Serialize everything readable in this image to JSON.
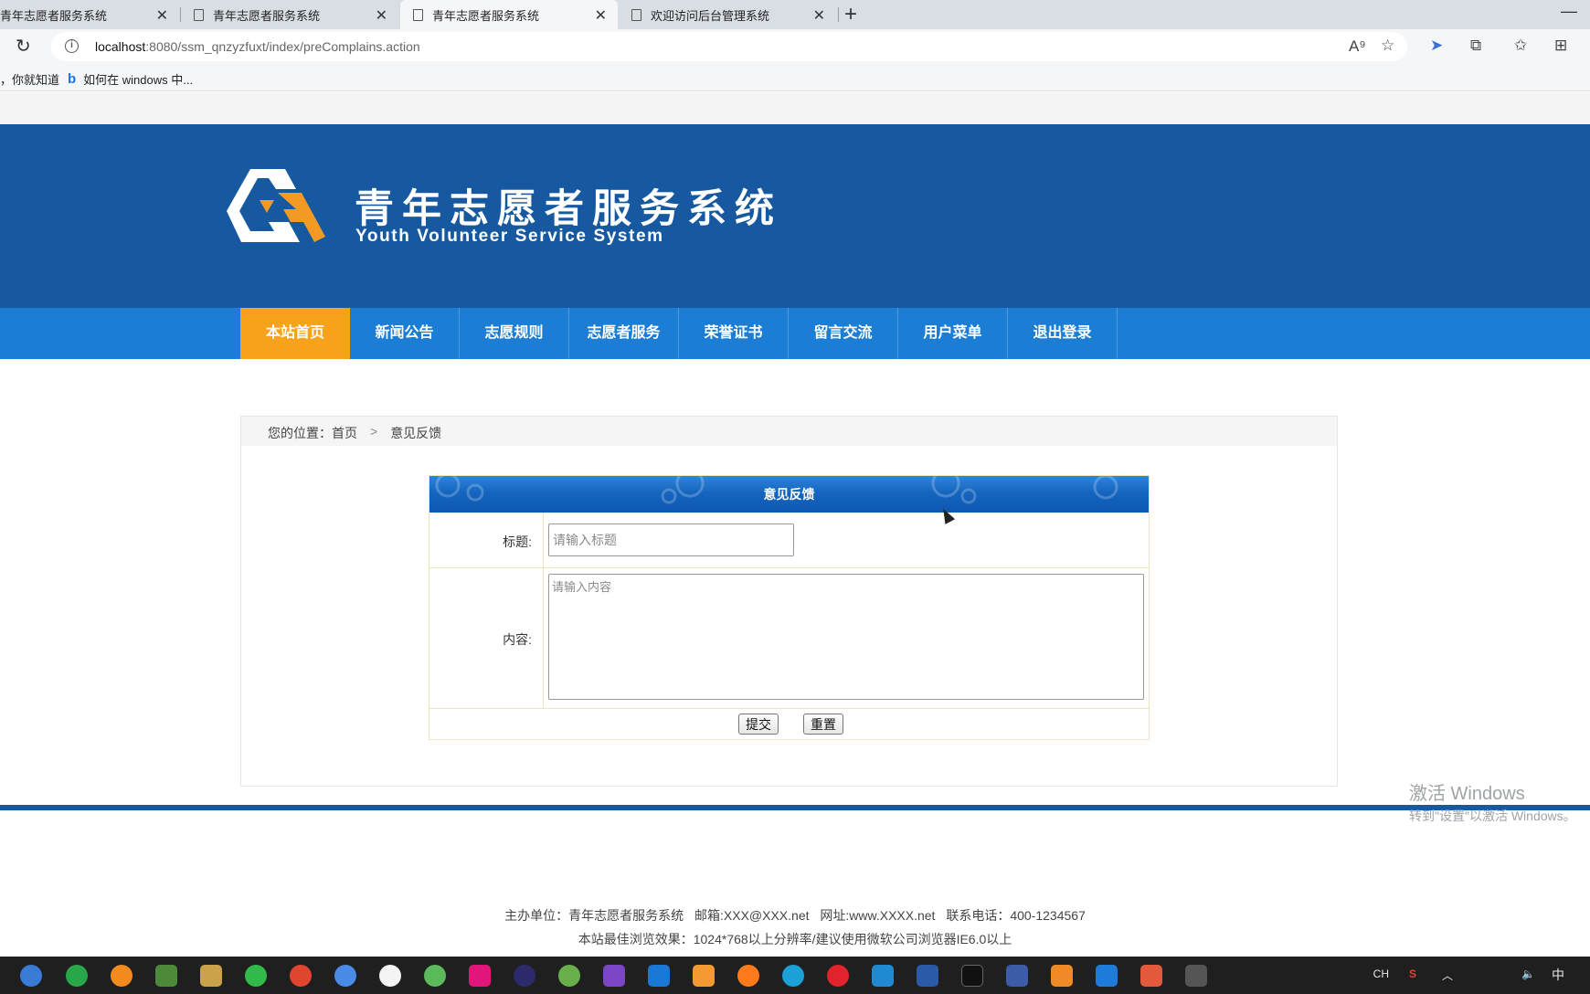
{
  "browser": {
    "tabs": [
      {
        "title": "青年志愿者服务系统",
        "active": false
      },
      {
        "title": "青年志愿者服务系统",
        "active": false
      },
      {
        "title": "青年志愿者服务系统",
        "active": true
      },
      {
        "title": "欢迎访问后台管理系统",
        "active": false
      }
    ],
    "new_tab_glyph": "+",
    "minimize_glyph": "—",
    "url_host": "localhost",
    "url_rest": ":8080/ssm_qnzyzfuxt/index/preComplains.action",
    "favorites": [
      {
        "label": "，你就知道"
      },
      {
        "label": "如何在 windows 中..."
      }
    ],
    "toolbar_icons": [
      "read-aloud-icon",
      "add-favorite-icon",
      "copilot-icon",
      "extensions-icon",
      "favorites-icon",
      "collections-icon"
    ]
  },
  "site": {
    "title": "青年志愿者服务系统",
    "subtitle": "Youth Volunteer Service System",
    "brand_color": "#1659a0",
    "nav_color": "#1b7ed4",
    "accent_color": "#f7a21b",
    "nav": [
      {
        "label": "本站首页",
        "active": true
      },
      {
        "label": "新闻公告",
        "active": false
      },
      {
        "label": "志愿规则",
        "active": false
      },
      {
        "label": "志愿者服务",
        "active": false
      },
      {
        "label": "荣誉证书",
        "active": false
      },
      {
        "label": "留言交流",
        "active": false
      },
      {
        "label": "用户菜单",
        "active": false
      },
      {
        "label": "退出登录",
        "active": false
      }
    ]
  },
  "breadcrumb": {
    "prefix": "您的位置：",
    "home": "首页",
    "separator": ">",
    "current": "意见反馈"
  },
  "form": {
    "heading": "意见反馈",
    "title_label": "标题:",
    "title_placeholder": "请输入标题",
    "title_value": "",
    "content_label": "内容:",
    "content_placeholder": "请输入内容",
    "content_value": "",
    "submit_label": "提交",
    "reset_label": "重置"
  },
  "footer": {
    "sponsor": "主办单位：青年志愿者服务系统",
    "email": "邮箱:XXX@XXX.net",
    "website": "网址:www.XXXX.net",
    "phone": "联系电话：400-1234567",
    "browser_note": "本站最佳浏览效果：1024*768以上分辨率/建议使用微软公司浏览器IE6.0以上"
  },
  "watermark": {
    "line1": "激活 Windows",
    "line2": "转到\"设置\"以激活 Windows。"
  },
  "taskbar": {
    "tray_lang": "CH",
    "tray_ime": "中",
    "icons": [
      "browser-icon",
      "wechat-green-icon",
      "orange-app-icon",
      "db-icon",
      "tools-icon",
      "wechat-icon",
      "chrome-icon",
      "chrome-alt-icon",
      "qq-icon",
      "leaf-icon",
      "intellij-icon",
      "eclipse-icon",
      "spring-icon",
      "visual-studio-icon",
      "app-m-icon",
      "sublime-icon",
      "firefox-icon",
      "edge-icon",
      "opera-icon",
      "vscode-icon",
      "powershell-icon",
      "terminal-icon",
      "feather-icon",
      "settings-app-icon",
      "word-icon",
      "pen-icon",
      "notes-icon"
    ]
  }
}
